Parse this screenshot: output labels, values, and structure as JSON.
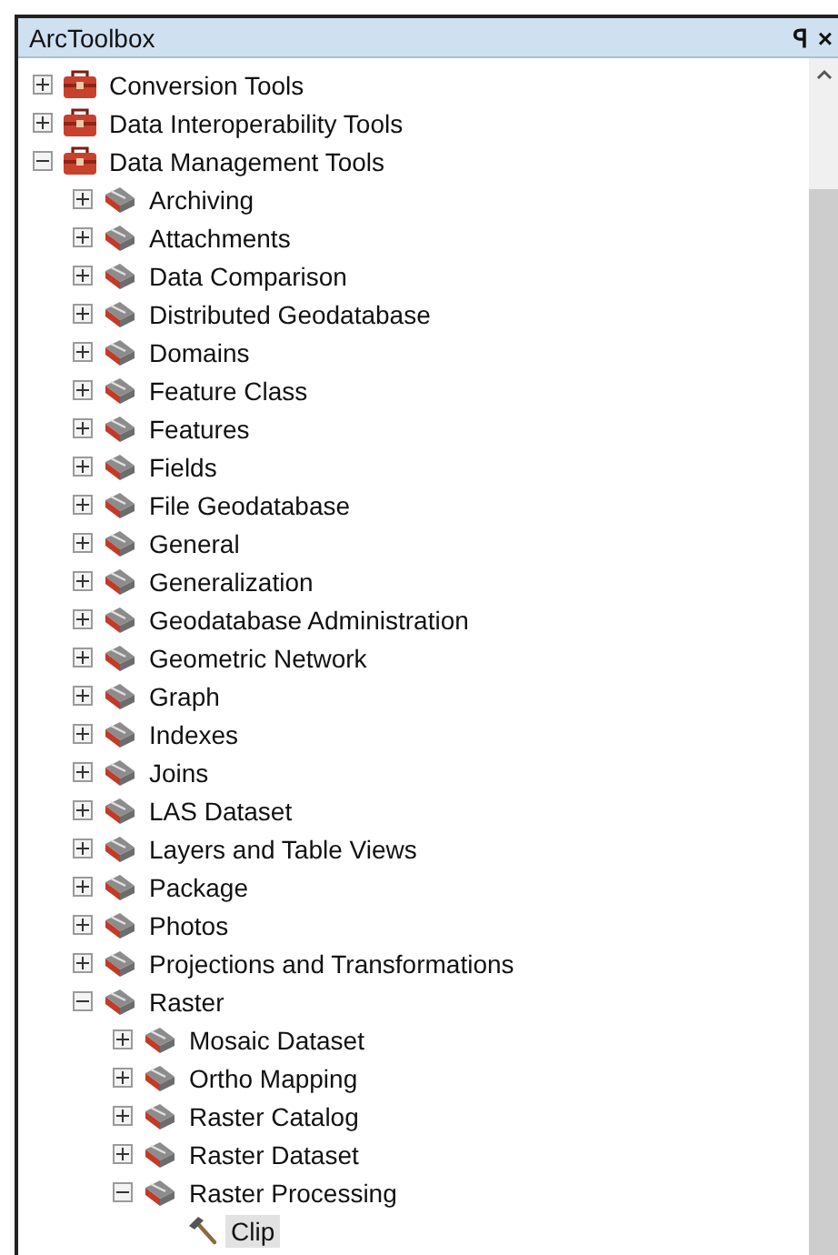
{
  "panel": {
    "title": "ArcToolbox",
    "pin": "ꟼ",
    "close": "×"
  },
  "tree": [
    {
      "label": "Conversion Tools",
      "kind": "toolbox",
      "expanded": false,
      "selected": false
    },
    {
      "label": "Data Interoperability Tools",
      "kind": "toolbox",
      "expanded": false,
      "selected": false
    },
    {
      "label": "Data Management Tools",
      "kind": "toolbox",
      "expanded": true,
      "selected": false,
      "children": [
        {
          "label": "Archiving",
          "kind": "toolset",
          "expanded": false,
          "selected": false
        },
        {
          "label": "Attachments",
          "kind": "toolset",
          "expanded": false,
          "selected": false
        },
        {
          "label": "Data Comparison",
          "kind": "toolset",
          "expanded": false,
          "selected": false
        },
        {
          "label": "Distributed Geodatabase",
          "kind": "toolset",
          "expanded": false,
          "selected": false
        },
        {
          "label": "Domains",
          "kind": "toolset",
          "expanded": false,
          "selected": false
        },
        {
          "label": "Feature Class",
          "kind": "toolset",
          "expanded": false,
          "selected": false
        },
        {
          "label": "Features",
          "kind": "toolset",
          "expanded": false,
          "selected": false
        },
        {
          "label": "Fields",
          "kind": "toolset",
          "expanded": false,
          "selected": false
        },
        {
          "label": "File Geodatabase",
          "kind": "toolset",
          "expanded": false,
          "selected": false
        },
        {
          "label": "General",
          "kind": "toolset",
          "expanded": false,
          "selected": false
        },
        {
          "label": "Generalization",
          "kind": "toolset",
          "expanded": false,
          "selected": false
        },
        {
          "label": "Geodatabase Administration",
          "kind": "toolset",
          "expanded": false,
          "selected": false
        },
        {
          "label": "Geometric Network",
          "kind": "toolset",
          "expanded": false,
          "selected": false
        },
        {
          "label": "Graph",
          "kind": "toolset",
          "expanded": false,
          "selected": false
        },
        {
          "label": "Indexes",
          "kind": "toolset",
          "expanded": false,
          "selected": false
        },
        {
          "label": "Joins",
          "kind": "toolset",
          "expanded": false,
          "selected": false
        },
        {
          "label": "LAS Dataset",
          "kind": "toolset",
          "expanded": false,
          "selected": false
        },
        {
          "label": "Layers and Table Views",
          "kind": "toolset",
          "expanded": false,
          "selected": false
        },
        {
          "label": "Package",
          "kind": "toolset",
          "expanded": false,
          "selected": false
        },
        {
          "label": "Photos",
          "kind": "toolset",
          "expanded": false,
          "selected": false
        },
        {
          "label": "Projections and Transformations",
          "kind": "toolset",
          "expanded": false,
          "selected": false
        },
        {
          "label": "Raster",
          "kind": "toolset",
          "expanded": true,
          "selected": false,
          "children": [
            {
              "label": "Mosaic Dataset",
              "kind": "toolset",
              "expanded": false,
              "selected": false
            },
            {
              "label": "Ortho Mapping",
              "kind": "toolset",
              "expanded": false,
              "selected": false
            },
            {
              "label": "Raster Catalog",
              "kind": "toolset",
              "expanded": false,
              "selected": false
            },
            {
              "label": "Raster Dataset",
              "kind": "toolset",
              "expanded": false,
              "selected": false
            },
            {
              "label": "Raster Processing",
              "kind": "toolset",
              "expanded": true,
              "selected": false,
              "children": [
                {
                  "label": "Clip",
                  "kind": "tool",
                  "selected": true
                }
              ]
            }
          ]
        }
      ]
    }
  ]
}
